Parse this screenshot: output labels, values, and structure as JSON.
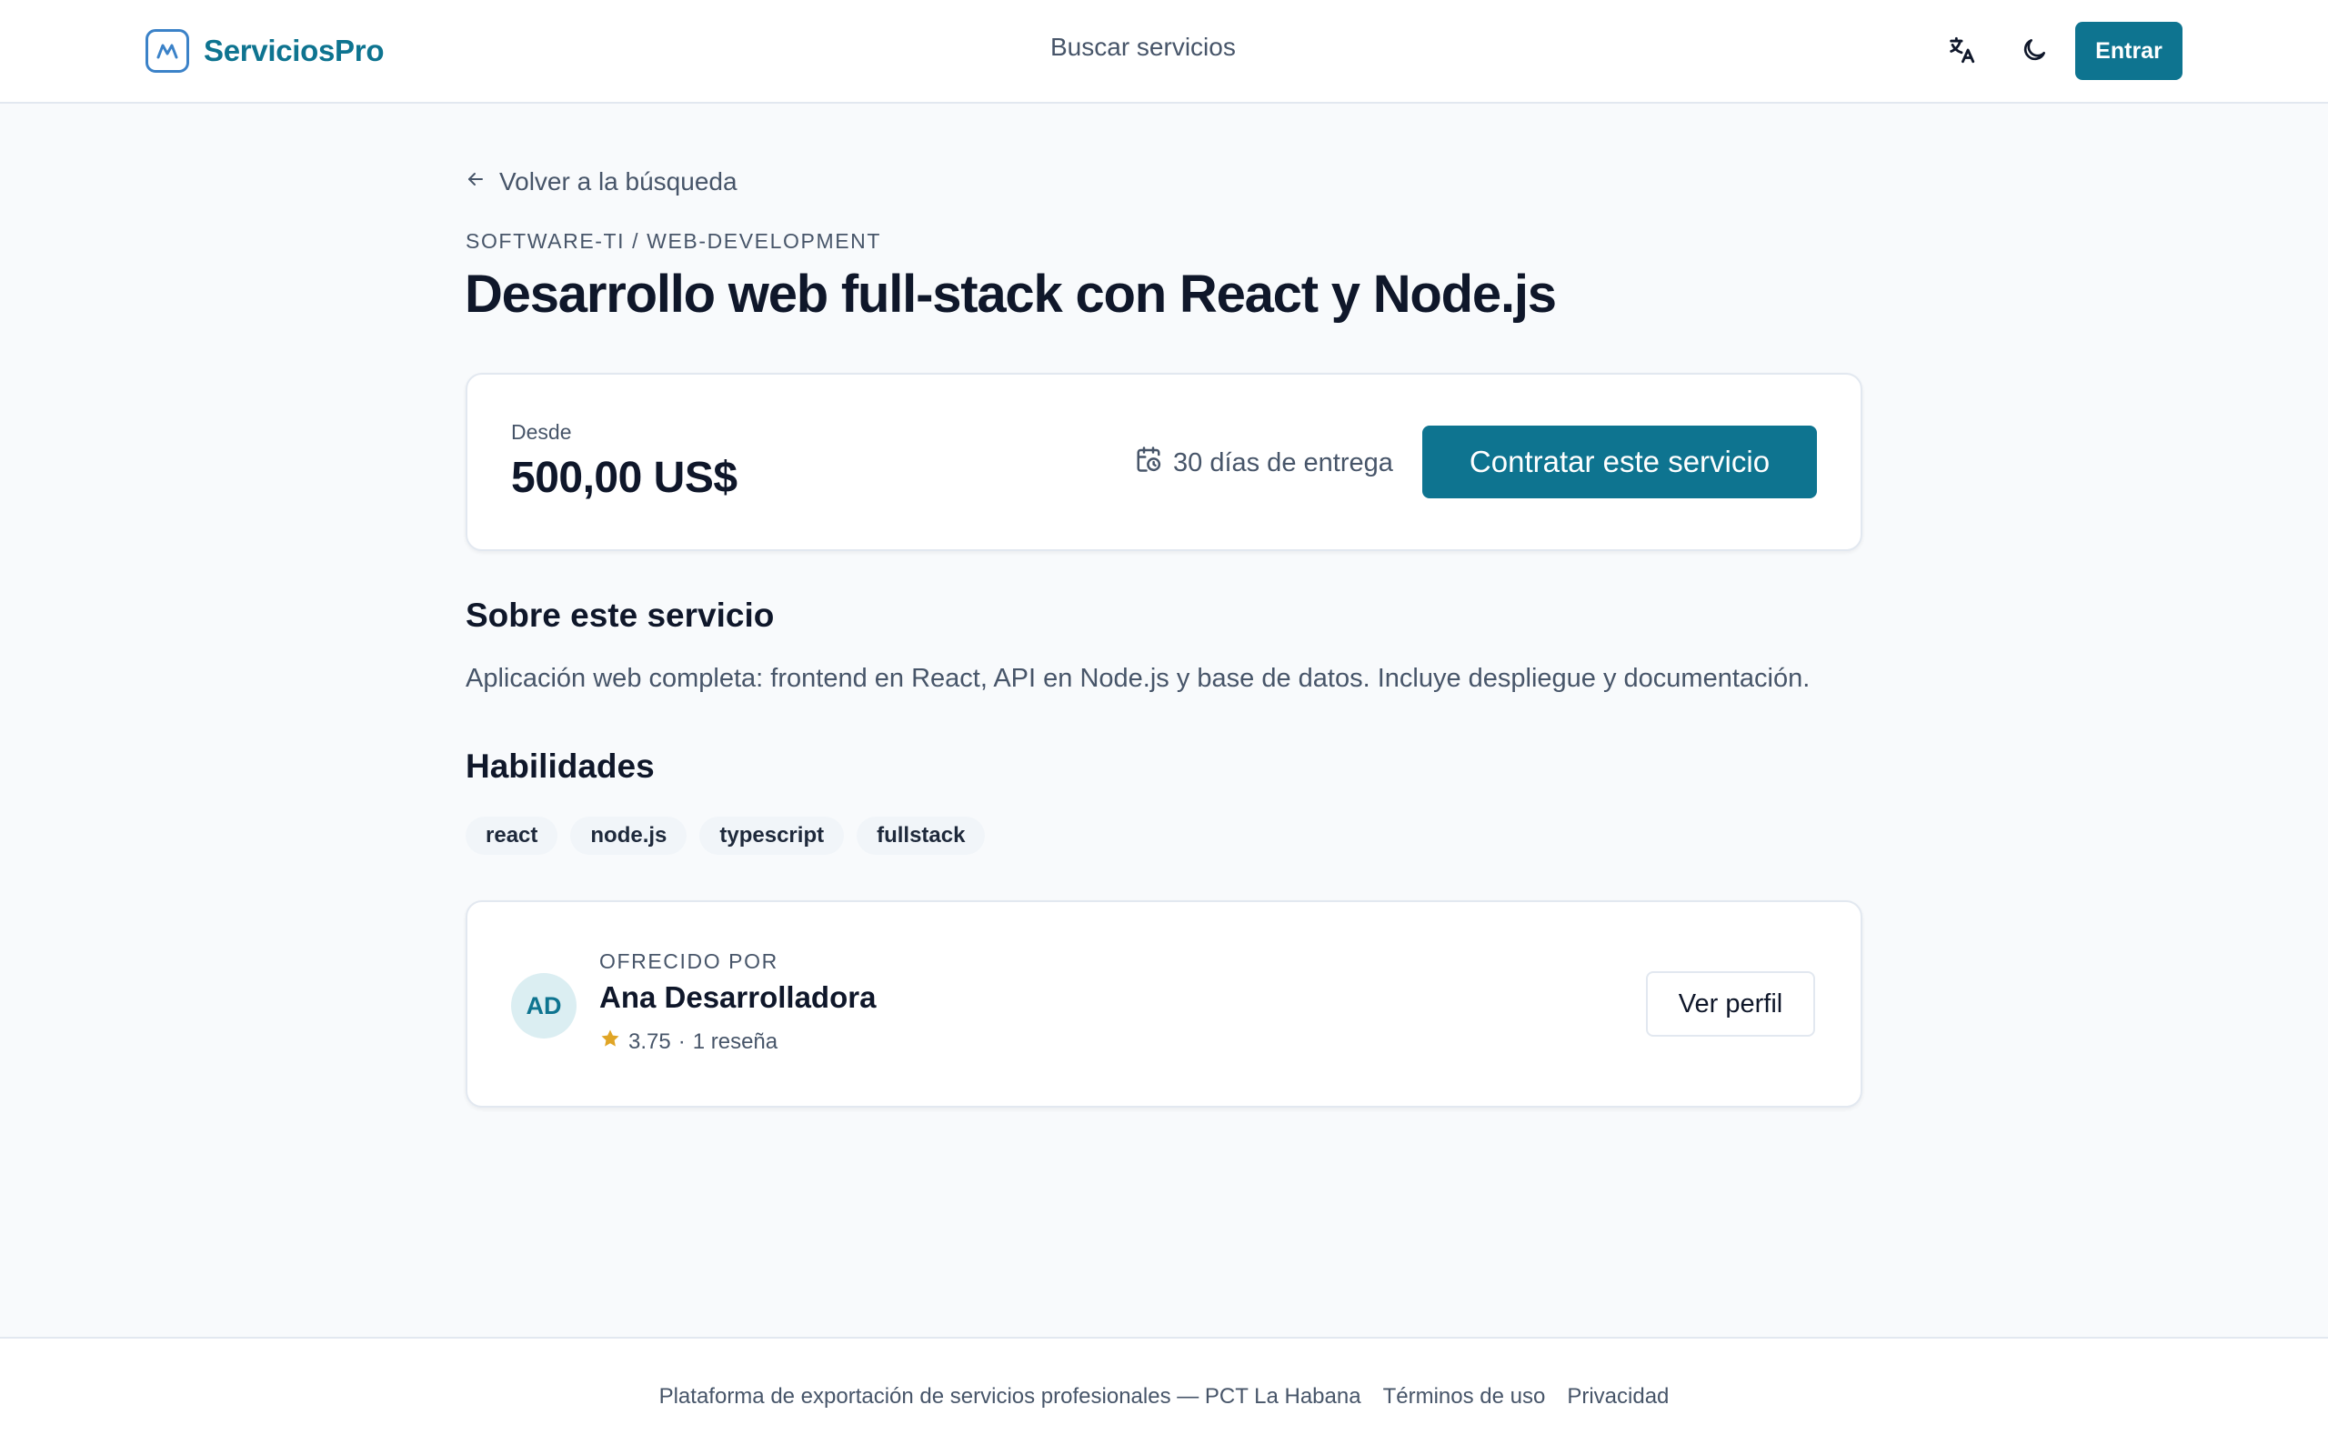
{
  "header": {
    "brand": "ServiciosPro",
    "nav_search": "Buscar servicios",
    "login_label": "Entrar"
  },
  "service": {
    "back_label": "Volver a la búsqueda",
    "breadcrumb": "SOFTWARE-TI / WEB-DEVELOPMENT",
    "title": "Desarrollo web full-stack con React y Node.js",
    "price_from_label": "Desde",
    "price": "500,00 US$",
    "delivery": "30 días de entrega",
    "hire_label": "Contratar este servicio",
    "about_heading": "Sobre este servicio",
    "description": "Aplicación web completa: frontend en React, API en Node.js y base de datos. Incluye despliegue y documentación.",
    "skills_heading": "Habilidades",
    "skills": [
      "react",
      "node.js",
      "typescript",
      "fullstack"
    ]
  },
  "seller": {
    "offered_by_label": "OFRECIDO POR",
    "initials": "AD",
    "name": "Ana Desarrolladora",
    "rating": "3.75",
    "separator": "·",
    "reviews": "1 reseña",
    "profile_label": "Ver perfil"
  },
  "footer": {
    "tagline": "Plataforma de exportación de servicios profesionales — PCT La Habana",
    "terms": "Términos de uso",
    "privacy": "Privacidad"
  },
  "colors": {
    "accent": "#0e7490",
    "star": "#e0a526",
    "background": "#f8fafc"
  },
  "icons": [
    "logo-icon",
    "translate-icon",
    "moon-icon",
    "arrow-left-icon",
    "calendar-clock-icon",
    "star-icon"
  ]
}
